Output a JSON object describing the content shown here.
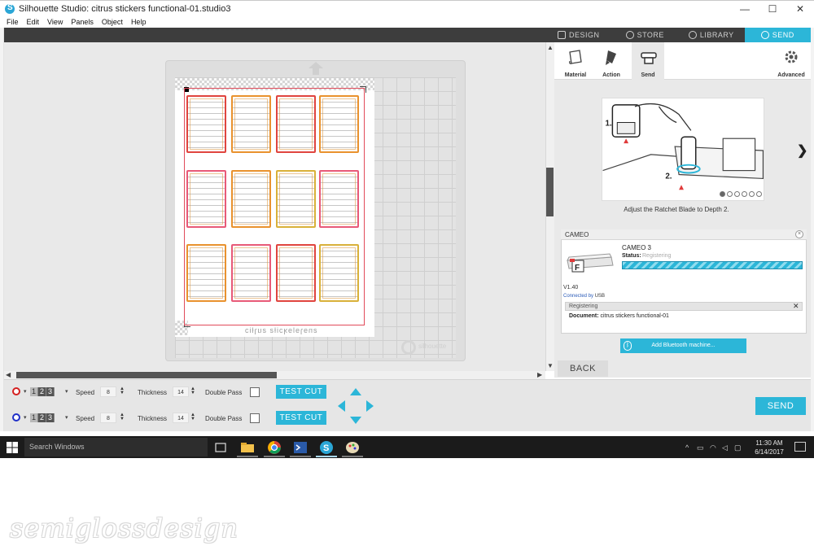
{
  "window": {
    "title": "Silhouette Studio: citrus stickers functional-01.studio3",
    "minimize": "—",
    "maximize": "☐",
    "close": "✕"
  },
  "menu": [
    "File",
    "Edit",
    "View",
    "Panels",
    "Object",
    "Help"
  ],
  "canvas": {
    "mirror_text": "ƨnɘɿɘlɘʞɔiƚƨ ƨuɿƚiɔ",
    "mat_logo_text": "silhouette",
    "sticker_colors": {
      "red": "#e0453f",
      "pink": "#e85a78",
      "orange": "#e9922e",
      "yellow": "#d9b13a"
    }
  },
  "panel": {
    "tabs": [
      {
        "label": "DESIGN",
        "icon": "grid-icon",
        "active": false
      },
      {
        "label": "STORE",
        "icon": "store-icon",
        "active": false
      },
      {
        "label": "LIBRARY",
        "icon": "cloud-icon",
        "active": false
      },
      {
        "label": "SEND",
        "icon": "check-circle-icon",
        "active": true
      }
    ],
    "sub_tabs": {
      "material": "Material",
      "action": "Action",
      "send": "Send",
      "advanced": "Advanced"
    },
    "tutorial": {
      "caption": "Adjust the Ratchet Blade to Depth 2.",
      "step1": "1.",
      "step2": "2.",
      "dots_total": 6,
      "dot_active": 0
    },
    "machine": {
      "header": "CAMEO",
      "name": "CAMEO 3",
      "status_label": "Status:",
      "status_value": "Registering",
      "progress_pct": 100,
      "version": "V1.40",
      "connected_label": "Connected by",
      "connected_value": "USB",
      "register_bar": "Registering",
      "document_label": "Document:",
      "document_value": "citrus stickers functional-01"
    },
    "bluetooth_button": "Add Bluetooth machine...",
    "back_button": "BACK"
  },
  "settings": {
    "rows": [
      {
        "color": "#d42020",
        "blade": [
          "1",
          "2",
          "3"
        ],
        "speed_label": "Speed",
        "speed": "8",
        "thickness_label": "Thickness",
        "thickness": "14",
        "double_pass_label": "Double Pass",
        "test_cut": "TEST CUT"
      },
      {
        "color": "#2030c8",
        "blade": [
          "1",
          "2",
          "3"
        ],
        "speed_label": "Speed",
        "speed": "8",
        "thickness_label": "Thickness",
        "thickness": "14",
        "double_pass_label": "Double Pass",
        "test_cut": "TEST CUT"
      }
    ],
    "send_button": "SEND"
  },
  "taskbar": {
    "search_placeholder": "Search Windows",
    "time": "11:30 AM",
    "date": "6/14/2017"
  },
  "watermark": "semiglossdesign"
}
